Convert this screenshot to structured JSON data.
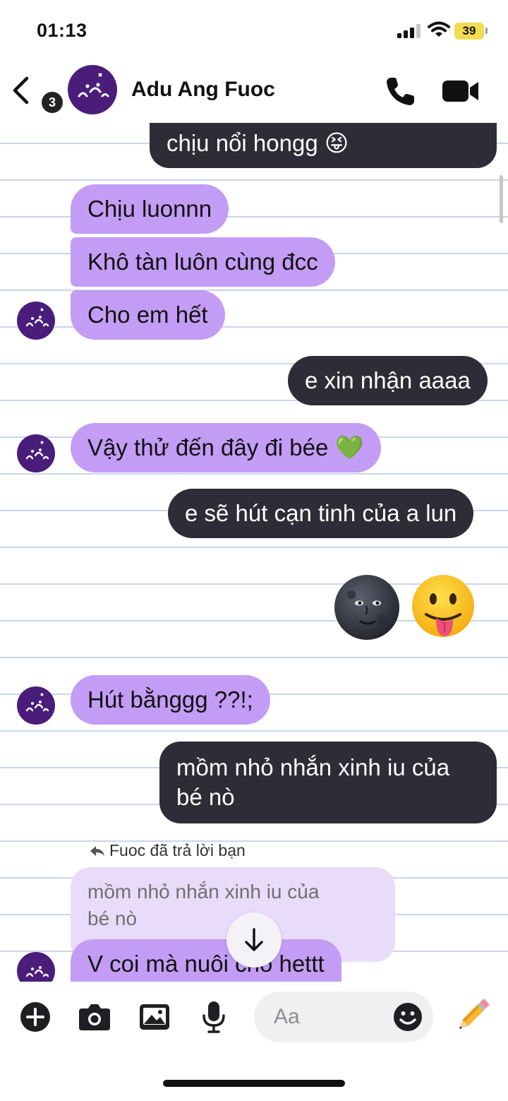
{
  "status_bar": {
    "time": "01:13",
    "battery": "39"
  },
  "header": {
    "back_count": "3",
    "contact_name": "Adu Ang Fuoc"
  },
  "messages": {
    "m1": "chịu nổi hongg 😝",
    "m2": "Chịu luonnn",
    "m3": "Khô tàn luôn cùng đcc",
    "m4": "Cho em hết",
    "m5": "e xin nhận aaaa",
    "m6": "Vậy thử đến đây đi bée 💚",
    "m7": "e sẽ hút cạn tinh của a lun",
    "m8_moon": "🌚",
    "m8_tongue": "😛",
    "m9": "Hút bằnggg ??!;",
    "m10_line1": "mồm nhỏ nhắn xinh iu của",
    "m10_line2": "bé nò",
    "m11": "V coi mà nuôi cho hettt"
  },
  "reply": {
    "label": "Fuoc đã trả lời bạn",
    "quoted_line1": "mồm nhỏ nhắn xinh iu của",
    "quoted_line2": "bé nò"
  },
  "composer": {
    "placeholder": "Aa"
  },
  "icons": {
    "back": "chevron-left-icon",
    "call": "phone-icon",
    "video": "video-camera-icon",
    "add": "plus-circle-icon",
    "camera": "camera-icon",
    "gallery": "image-icon",
    "mic": "microphone-icon",
    "emoji": "smiley-icon",
    "pencil": "pencil-icon",
    "scroll_down": "arrow-down-icon"
  },
  "colors": {
    "incoming_bubble": "#c39df5",
    "outgoing_bubble": "#2e2c36",
    "quoted_bubble": "#e9dcfa",
    "battery": "#f3db52",
    "avatar": "#4a1d7a"
  }
}
